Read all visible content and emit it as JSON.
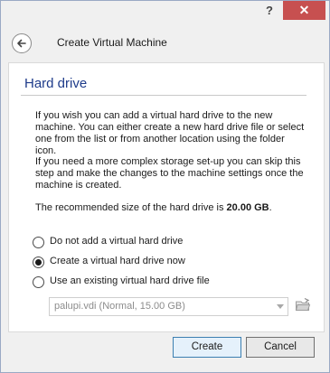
{
  "titlebar": {
    "help_label": "?",
    "close_label": "✕"
  },
  "header": {
    "title": "Create Virtual Machine"
  },
  "page": {
    "heading": "Hard drive",
    "para1": "If you wish you can add a virtual hard drive to the new machine. You can either create a new hard drive file or select one from the list or from another location using the folder icon.",
    "para2": "If you need a more complex storage set-up you can skip this step and make the changes to the machine settings once the machine is created.",
    "para3_prefix": "The recommended size of the hard drive is ",
    "para3_size": "20.00 GB",
    "para3_suffix": ".",
    "options": [
      {
        "label": "Do not add a virtual hard drive",
        "checked": false
      },
      {
        "label": "Create a virtual hard drive now",
        "checked": true
      },
      {
        "label": "Use an existing virtual hard drive file",
        "checked": false
      }
    ],
    "existing_file": {
      "value": "palupi.vdi (Normal, 15.00 GB)",
      "enabled": false
    }
  },
  "footer": {
    "create_label": "Create",
    "cancel_label": "Cancel"
  },
  "colors": {
    "heading": "#1e3b8a",
    "close_button": "#c75050"
  }
}
